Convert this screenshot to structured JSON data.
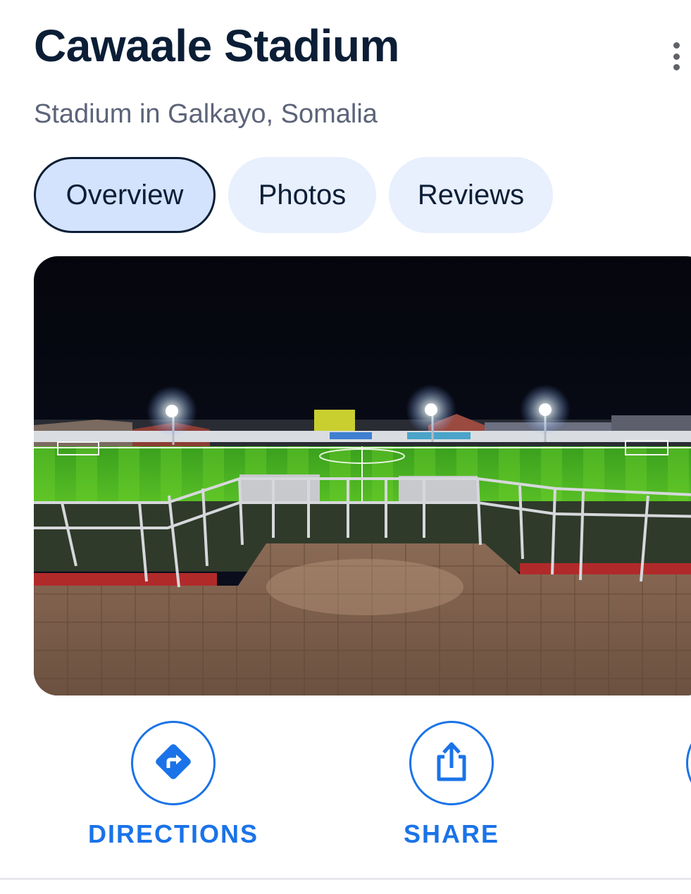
{
  "place": {
    "name": "Cawaale Stadium",
    "subtitle": "Stadium in Galkayo, Somalia"
  },
  "tabs": [
    {
      "label": "Overview",
      "active": true
    },
    {
      "label": "Photos",
      "active": false
    },
    {
      "label": "Reviews",
      "active": false
    }
  ],
  "actions": {
    "directions": {
      "label": "DIRECTIONS",
      "icon": "directions-icon"
    },
    "share": {
      "label": "SHARE",
      "icon": "share-icon"
    }
  },
  "icons": {
    "more": "more-vert-icon"
  },
  "colors": {
    "accent": "#1a73e8",
    "title": "#0b1e36",
    "tab_bg": "#e8effd",
    "tab_active_bg": "#d3e3fd"
  }
}
